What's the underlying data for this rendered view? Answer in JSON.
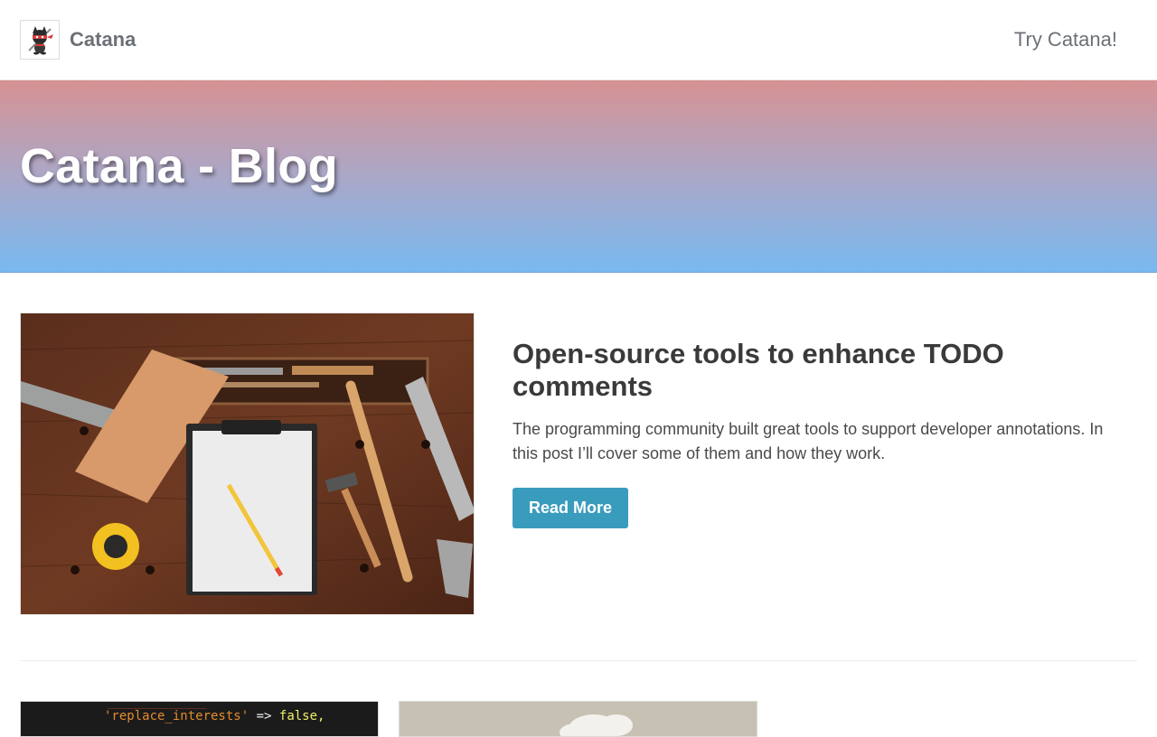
{
  "nav": {
    "brand_name": "Catana",
    "brand_logo_icon": "ninja-cat-logo-icon",
    "cta_link": "Try Catana!"
  },
  "hero": {
    "title": "Catana - Blog"
  },
  "featured_post": {
    "image_icon": "workbench-tools-photo",
    "title": "Open-source tools to enhance TODO comments",
    "excerpt": "The programming community built great tools to support developer annotations. In this post I’ll cover some of them and how they work.",
    "button_label": "Read More"
  },
  "more_posts": [
    {
      "image_icon": "code-screen-photo",
      "code_line_key": "'replace_interests'",
      "code_line_arrow": "=>",
      "code_line_value": "false,"
    },
    {
      "image_icon": "cloud-photo"
    }
  ],
  "colors": {
    "accent": "#3a9cbd",
    "hero_top": "#d69293",
    "hero_bottom": "#78b9f0",
    "text": "#3a3a3a",
    "muted": "#6c7177"
  }
}
